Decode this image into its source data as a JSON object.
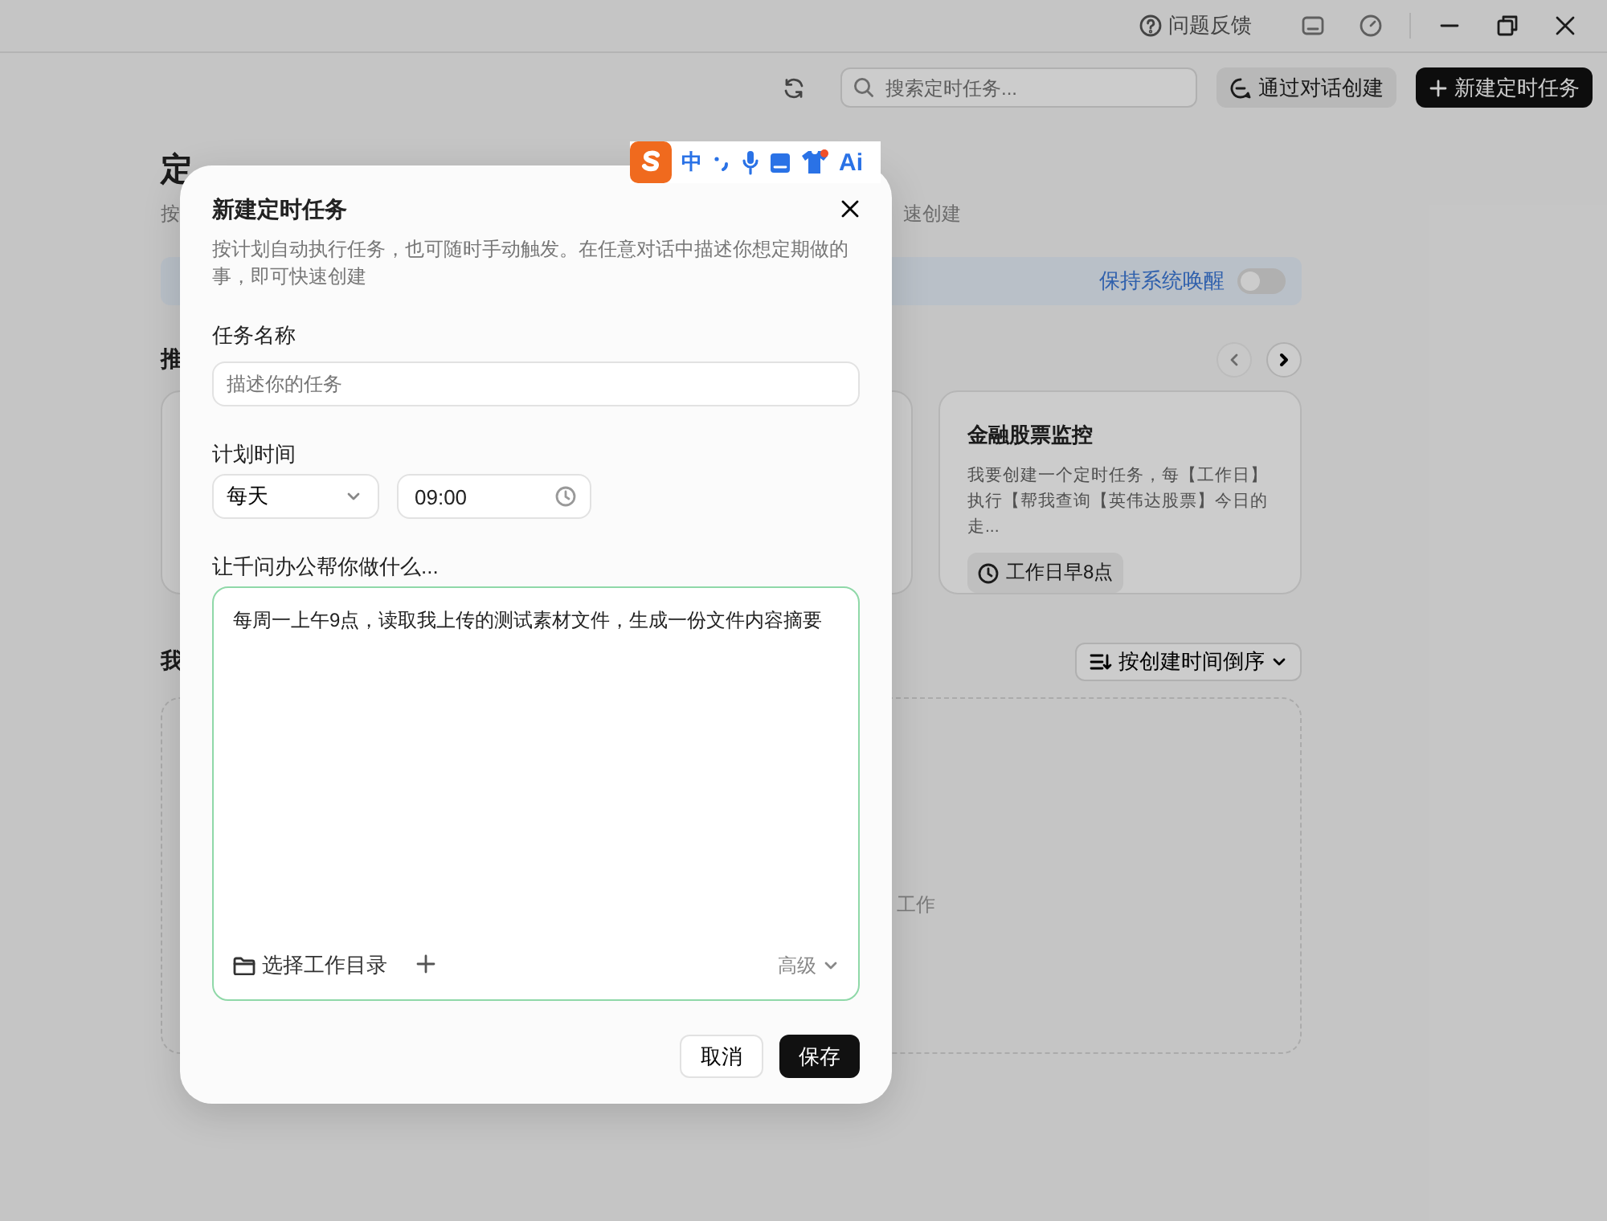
{
  "title_bar": {
    "feedback": "问题反馈"
  },
  "toolbar": {
    "search": {
      "placeholder": "搜索定时任务..."
    },
    "chat_create": "通过对话创建",
    "new_task": "新建定时任务"
  },
  "page": {
    "title": "定",
    "subtitle_start": "按",
    "subtitle_end": "速创建",
    "keep_awake": {
      "label": "保持系统唤醒",
      "on": false
    },
    "recommended_label": "推",
    "carousel": {
      "prev_disabled": true,
      "next_disabled": false
    },
    "recommended_cards": [
      {
        "title": "金融股票监控",
        "description": "我要创建一个定时任务，每【工作日】执行【帮我查询【英伟达股票】今日的走...",
        "schedule": "工作日早8点"
      }
    ],
    "my_tasks_label": "我",
    "sort": "按创建时间倒序",
    "empty_text": "工作"
  },
  "ime_bar": {
    "mode": "中",
    "ai": "Ai"
  },
  "dialog": {
    "title": "新建定时任务",
    "description": "按计划自动执行任务，也可随时手动触发。在任意对话中描述你想定期做的事，即可快速创建",
    "name_label": "任务名称",
    "name_field": {
      "placeholder": "描述你的任务"
    },
    "schedule_label": "计划时间",
    "frequency": "每天",
    "time": "09:00",
    "prompt_label": "让千问办公帮你做什么...",
    "prompt": {
      "value": "每周一上午9点，读取我上传的测试素材文件，生成一份文件内容摘要",
      "focused": true
    },
    "workdir": "选择工作目录",
    "advanced": "高级",
    "cancel": "取消",
    "save": "保存"
  }
}
